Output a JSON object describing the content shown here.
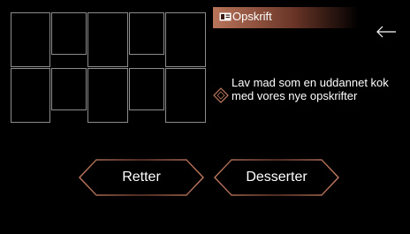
{
  "header": {
    "title": "Opskrift",
    "icon": "recipe-card-icon"
  },
  "back": {
    "icon": "back-arrow-icon"
  },
  "description": {
    "text": "Lav mad som en uddannet kok med vores nye opskrifter",
    "icon": "diamond-icon"
  },
  "buttons": [
    {
      "label": "Retter"
    },
    {
      "label": "Desserter"
    }
  ],
  "colors": {
    "accent": "#c07a60",
    "tile_border": "#8c8c8c",
    "background": "#000000"
  }
}
